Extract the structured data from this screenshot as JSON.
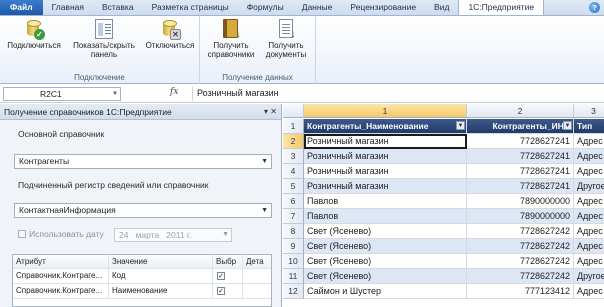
{
  "tabs": [
    "Файл",
    "Главная",
    "Вставка",
    "Разметка страницы",
    "Формулы",
    "Данные",
    "Рецензирование",
    "Вид",
    "1С:Предприятие"
  ],
  "active_tab": "1С:Предприятие",
  "ribbon": {
    "group_connection": {
      "label": "Подключение",
      "connect": "Подключиться",
      "toggle_panel_1": "Показать/скрыть",
      "toggle_panel_2": "панель",
      "disconnect": "Отключиться"
    },
    "group_data": {
      "label": "Получение данных",
      "get_refs_1": "Получить",
      "get_refs_2": "справочники",
      "get_docs_1": "Получить",
      "get_docs_2": "документы"
    }
  },
  "formula_bar": {
    "name_box": "R2C1",
    "fx": "fx",
    "content": "Розничный магазин"
  },
  "pane": {
    "title": "Получение справочников 1С:Предприятие",
    "controls": "▾ ✕",
    "main_ref_label": "Основной справочник",
    "main_ref_value": "Контрагенты",
    "sub_label": "Подчиненный регистр сведений или справочник",
    "sub_value": "КонтактнаяИнформация",
    "use_date_label": "Использовать дату",
    "date_day": "24",
    "date_month": "марта",
    "date_year": "2011 г.",
    "grid_headers": [
      "Атрибут",
      "Значение",
      "Выбр",
      "Дета"
    ],
    "grid_rows": [
      {
        "attr": "Справочник.Контраге...",
        "value": "Код",
        "checked": "✓"
      },
      {
        "attr": "Справочник.Контраге...",
        "value": "Наименование",
        "checked": "✓"
      }
    ]
  },
  "sheet": {
    "col_headers": [
      "1",
      "2",
      "3"
    ],
    "row_headers": [
      "1",
      "2",
      "3",
      "4",
      "5",
      "6",
      "7",
      "8",
      "9",
      "10",
      "11",
      "12"
    ],
    "header_row": [
      "Контрагенты_Наименование",
      "Контрагенты_ИНН",
      "Тип"
    ],
    "rows": [
      [
        "Розничный магазин",
        "7728627241",
        "Адрес"
      ],
      [
        "Розничный магазин",
        "7728627241",
        "Адрес"
      ],
      [
        "Розничный магазин",
        "7728627241",
        "Адрес"
      ],
      [
        "Розничный магазин",
        "7728627241",
        "Другое"
      ],
      [
        "Павлов",
        "7890000000",
        "Адрес"
      ],
      [
        "Павлов",
        "7890000000",
        "Адрес"
      ],
      [
        "Свет (Ясенево)",
        "7728627242",
        "Адрес"
      ],
      [
        "Свет (Ясенево)",
        "7728627242",
        "Адрес"
      ],
      [
        "Свет (Ясенево)",
        "7728627242",
        "Адрес"
      ],
      [
        "Свет (Ясенево)",
        "7728627242",
        "Другое"
      ],
      [
        "Саймон и Шустер",
        "777123412",
        "Адрес"
      ]
    ]
  }
}
